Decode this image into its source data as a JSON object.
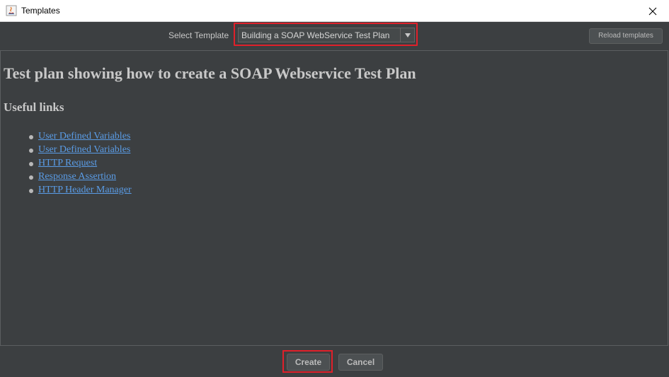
{
  "window": {
    "title": "Templates"
  },
  "toolbar": {
    "select_label": "Select Template",
    "selected_template": "Building a SOAP WebService Test Plan",
    "reload_label": "Reload templates"
  },
  "content": {
    "heading": "Test plan showing how to create a SOAP Webservice Test Plan",
    "subheading": "Useful links",
    "links": [
      {
        "label": "User Defined Variables"
      },
      {
        "label": "User Defined Variables"
      },
      {
        "label": "HTTP Request"
      },
      {
        "label": "Response Assertion"
      },
      {
        "label": "HTTP Header Manager"
      }
    ]
  },
  "buttons": {
    "create_label": "Create",
    "cancel_label": "Cancel"
  },
  "colors": {
    "background": "#3c3f41",
    "link": "#5a9ce6",
    "highlight": "#e0202a"
  }
}
